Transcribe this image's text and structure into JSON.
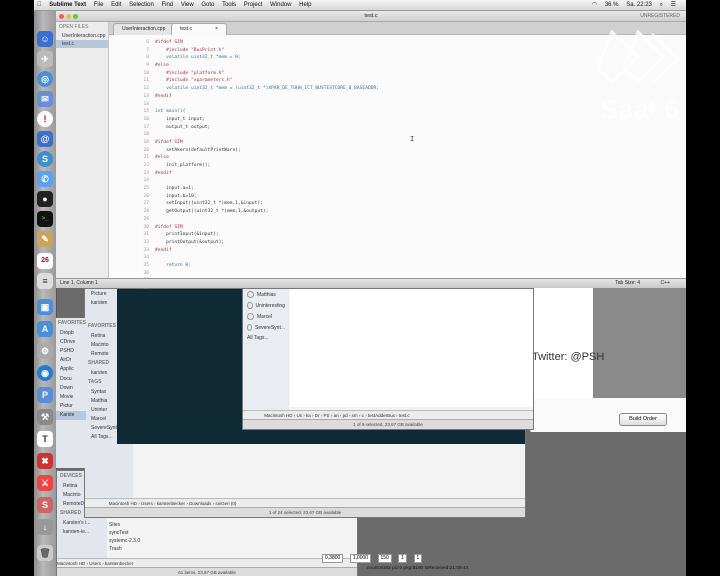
{
  "menubar": {
    "app_name": "Sublime Text",
    "items": [
      "File",
      "Edit",
      "Selection",
      "Find",
      "View",
      "Goto",
      "Tools",
      "Project",
      "Window",
      "Help"
    ],
    "battery": "36 %",
    "clock": "Sa. 22:23"
  },
  "sublime": {
    "window_title": "test.c",
    "unregistered": "UNREGISTERED",
    "sidebar_header": "OPEN FILES",
    "open_files": [
      "UserInteraction.cpp",
      "test.c"
    ],
    "tabs": [
      "UserInteraction.cpp",
      "test.c"
    ],
    "line_numbers": [
      "6",
      "7",
      "8",
      "9",
      "10",
      "11",
      "12",
      "13",
      "14",
      "15",
      "16",
      "17",
      "18",
      "19",
      "20",
      "21",
      "22",
      "23",
      "24",
      "25",
      "26",
      "27",
      "28",
      "29",
      "30",
      "31",
      "32",
      "33",
      "34",
      "35",
      "36",
      "37",
      "38"
    ],
    "code_lines": [
      "#ifdef SIM",
      "    #include \"BusPrint.h\"",
      "    volatile uint32_t *mem = 0;",
      "#else",
      "    #include \"platform.h\"",
      "    #include \"xparameters.h\"",
      "    volatile uint32_t *mem = (uint32_t *)XPAR_DE_TUHH_ICT_BUSTESTCORE_0_BASEADDR;",
      "#endif",
      "",
      "int main(){",
      "    input_t input;",
      "    output_t output;",
      "",
      "#ifdef SIM",
      "    setAkern(defaultPrintWarn);",
      "#else",
      "    init_platform();",
      "#endif",
      "",
      "    input.a=1;",
      "    input.b=10;",
      "    setInput((uint32_t *)mem,1,&input);",
      "    getOutput((uint32_t *)mem,1,&output);",
      "",
      "#ifdef SIM",
      "    printInput(&input);",
      "    printOutput(&output);",
      "#endif",
      "",
      "    return 0;",
      "",
      "",
      ""
    ],
    "status_left": "Line 1, Column 1",
    "tab_size": "Tab Size: 4",
    "syntax": "C++"
  },
  "overlay": {
    "saal_label": "Saal 6",
    "twitter": "Twitter: @PSH",
    "build_button": "Build Order"
  },
  "finder_front": {
    "tags": [
      "Matthias",
      "Uninteresting",
      "Marcel",
      "SevereSynt...",
      "All Tags..."
    ],
    "path": [
      "Macintosh HD",
      "Us",
      "ka",
      "Dr",
      "PS",
      "an",
      "pd",
      "sm",
      "c",
      "testAdderBus",
      "test.c"
    ],
    "status": "1 of 9 selected, 23,67 GB available"
  },
  "finder_mid": {
    "sidebar_top": [
      "Picture",
      "karsten"
    ],
    "favorites_header": "FAVORITES",
    "favorites": [
      "Dropb",
      "CDrive",
      "PSHD",
      "AirDr",
      "Applic",
      "Docu",
      "Down",
      "Movie",
      "Pictur",
      "Karste"
    ],
    "devices_header": "DEVICES",
    "devices": [
      "Retina",
      "Macinto",
      "Remote"
    ],
    "shared_header": "SHARED",
    "shared": [
      "karsten"
    ],
    "tags_header": "TAGS",
    "tags": [
      "Syntax",
      "Matthia",
      "Uninter",
      "Marcel",
      "SevereSynt...",
      "All Tags..."
    ],
    "path": [
      "Macintosh HD",
      "Users",
      "karstenbecker",
      "Downloads",
      "sniGen (0)"
    ],
    "status": "1 of 24 selected, 23,67 GB available"
  },
  "finder_back": {
    "devices_header": "DEVICES",
    "devices": [
      "Retina",
      "Macinto",
      "RemoteDisc"
    ],
    "shared_header": "SHARED",
    "shared": [
      "Karsten's i...",
      "karsten-ie..."
    ],
    "files": [
      "Sites",
      "syncTest",
      "systemc-2.3.0",
      "Trash"
    ],
    "path": [
      "Macintosh HD",
      "Users",
      "karstenbecker"
    ],
    "status": "61 items, 23,67 GB available"
  },
  "bottom_fields": {
    "values": [
      "0,3800",
      "1,0000",
      "150",
      "1",
      "1"
    ],
    "stats": "count:8192 pic:0 pkg:8180 txReceived:21:09:44"
  },
  "colors": {
    "menubar": "#e6e6e6",
    "editor_bg": "#fbfbfb",
    "dark_panel": "#0f2a35"
  }
}
